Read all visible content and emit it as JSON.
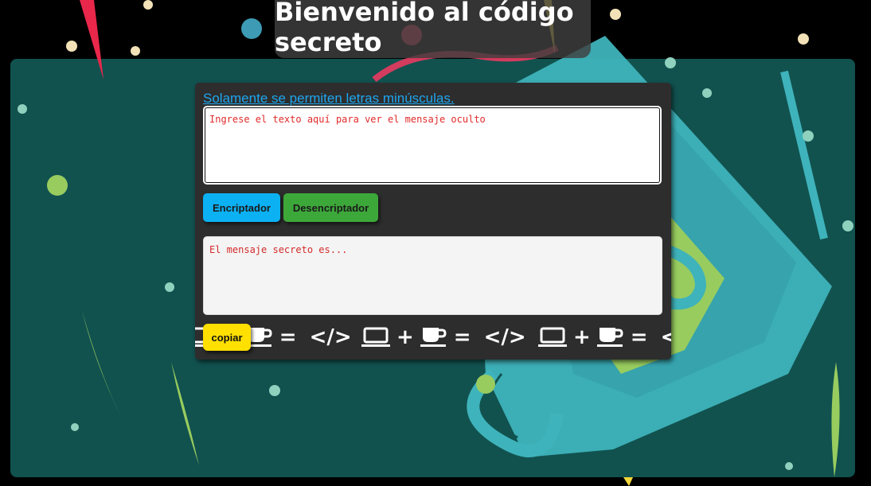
{
  "header": {
    "title": "Bienvenido al código secreto"
  },
  "form": {
    "hint": "Solamente se permiten letras minúsculas.",
    "input_placeholder": "Ingrese el texto aquí para ver el mensaje oculto",
    "encrypt_label": "Encriptador",
    "decrypt_label": "Desencriptador",
    "output_placeholder": "El mensaje secreto es...",
    "copy_label": "copiar"
  },
  "ticker": {
    "plus": "+",
    "equals": "=",
    "code": "</>",
    "laptop_icon": "laptop-icon",
    "cup_icon": "coffee-cup-icon"
  },
  "colors": {
    "panel": "#11524f",
    "card": "#2d2d2d",
    "hint": "#1ea7f0",
    "encrypt_button": "#0cb1f3",
    "decrypt_button": "#3da83a",
    "copy_button": "#ffe000",
    "placeholder_text": "#e02b2b"
  }
}
